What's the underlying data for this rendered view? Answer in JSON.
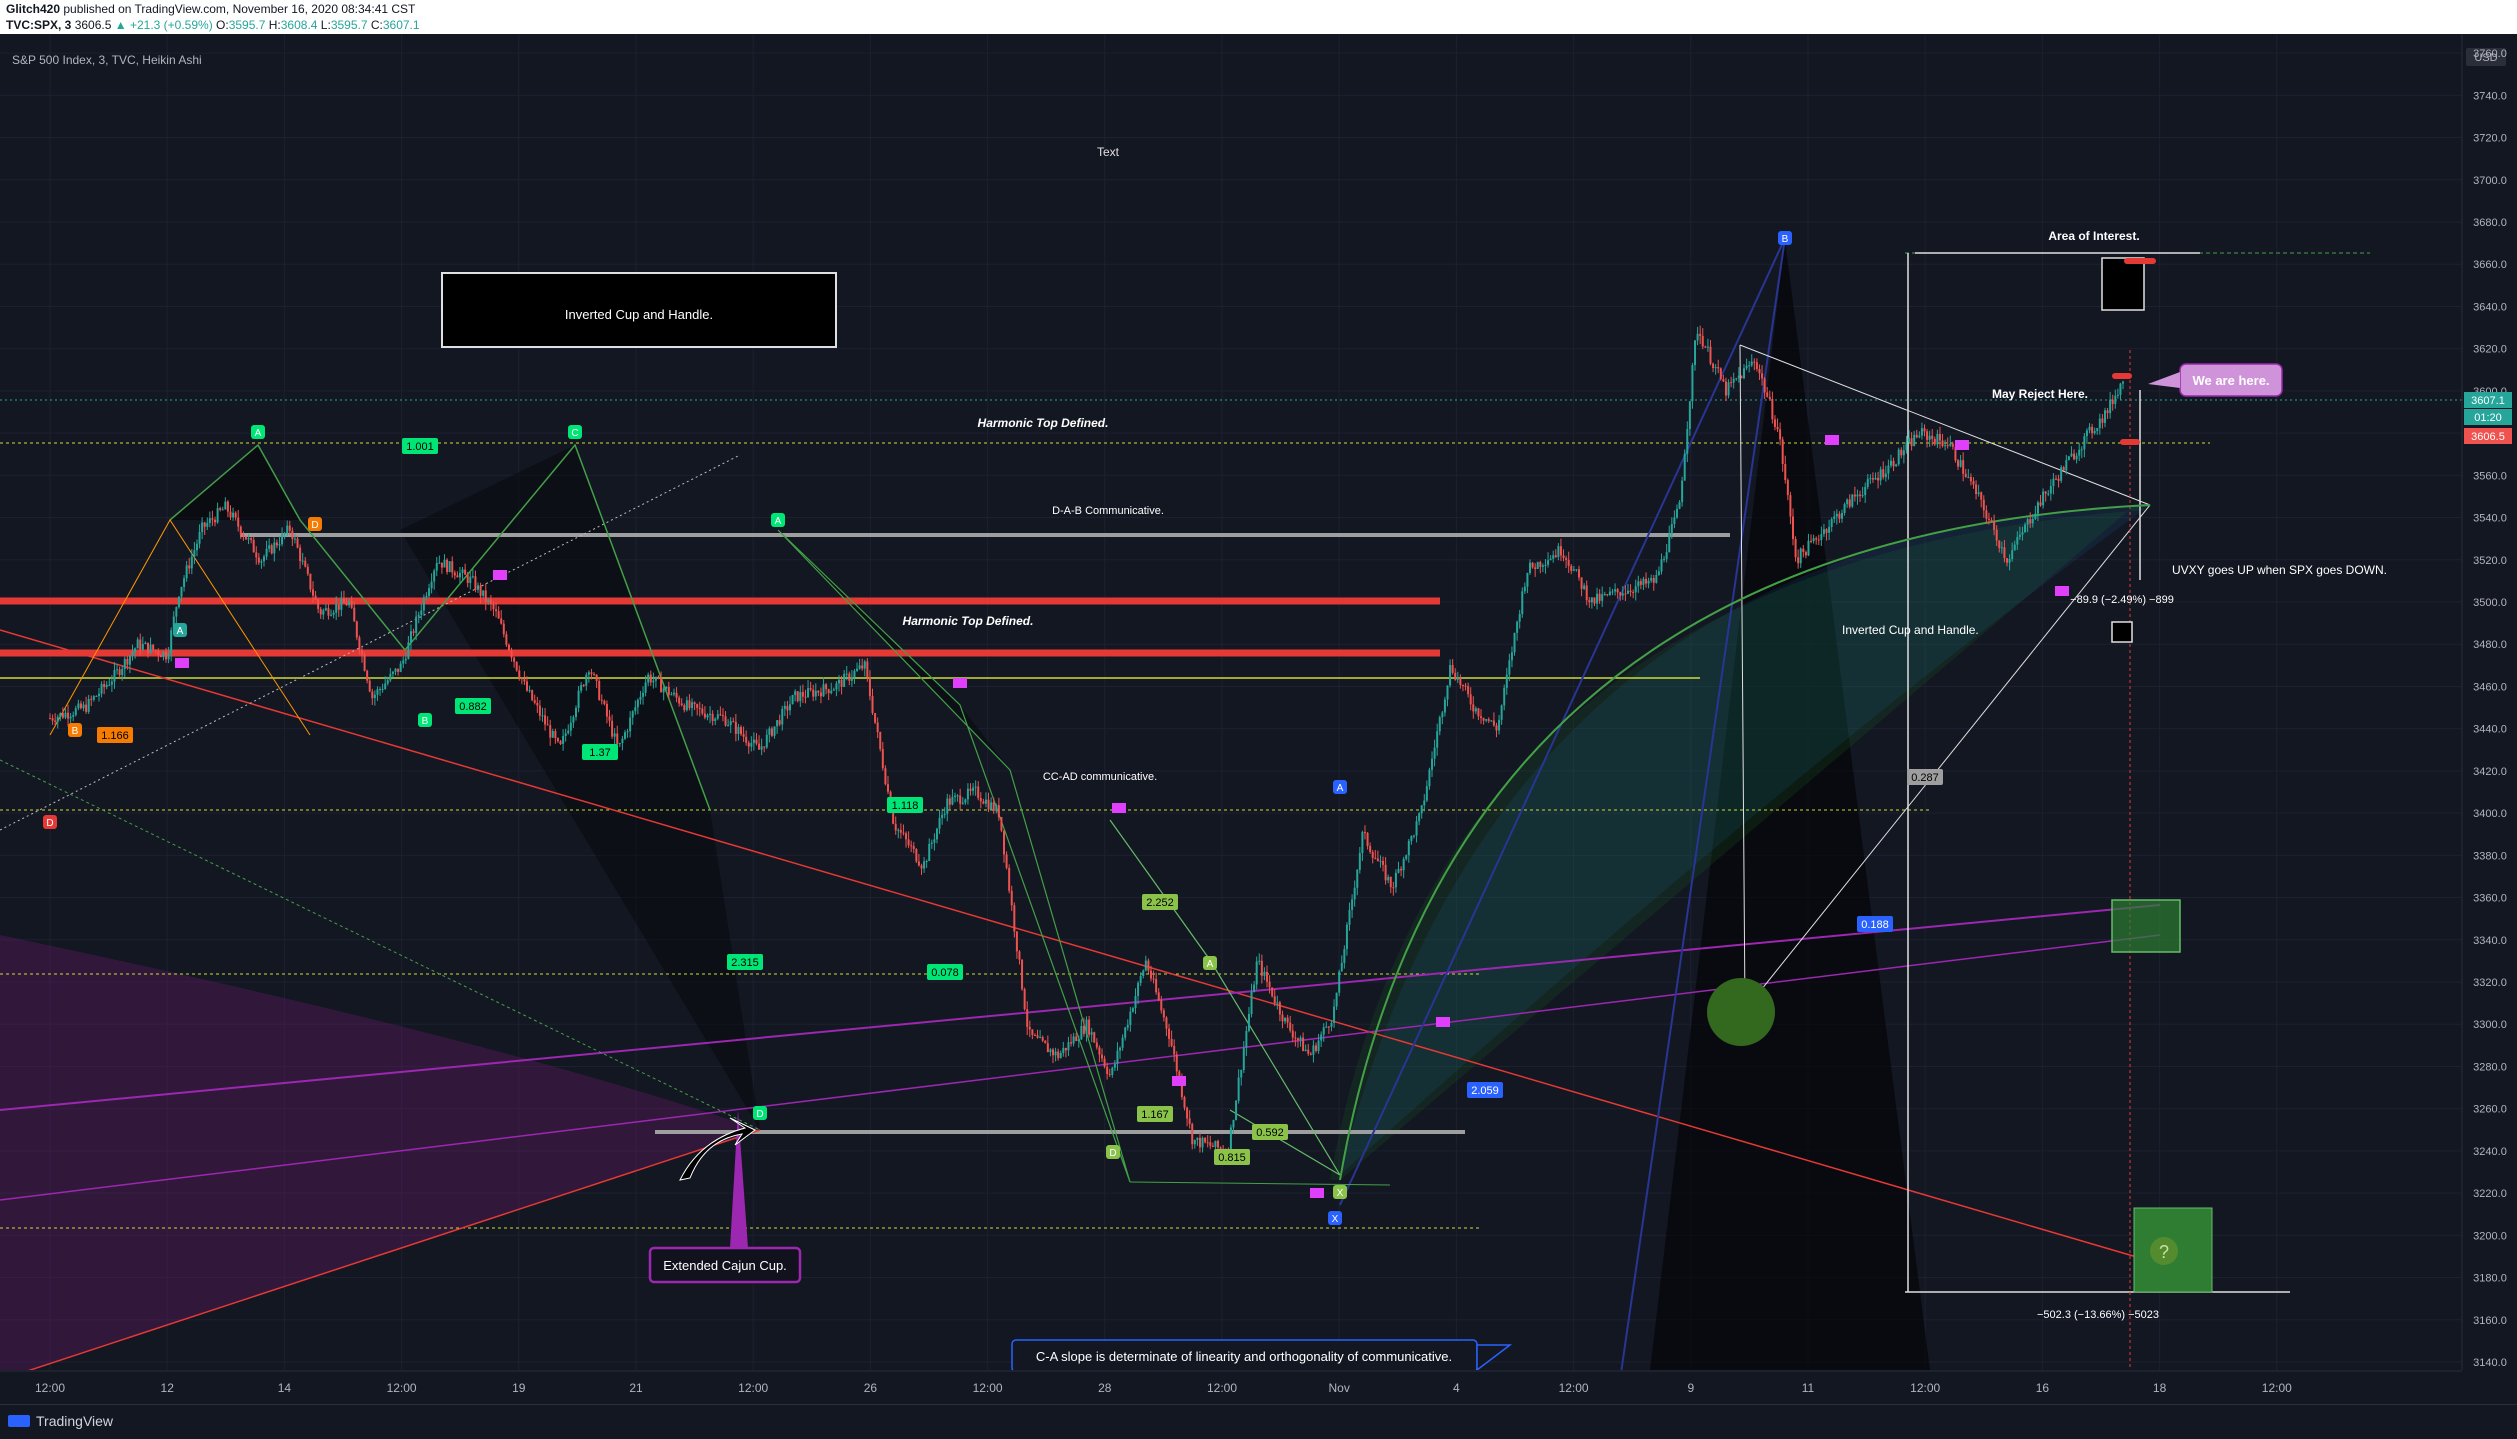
{
  "header": {
    "author": "Glitch420",
    "published_text": "published on TradingView.com, November 16, 2020 08:34:41 CST",
    "symbol": "TVC:SPX, 3",
    "last": "3606.5",
    "change": "▲ +21.3 (+0.59%)",
    "o_label": "O:",
    "o": "3595.7",
    "h_label": "H:",
    "h": "3608.4",
    "l_label": "L:",
    "l": "3595.7",
    "c_label": "C:",
    "c": "3607.1"
  },
  "legend_title": "S&P 500 Index, 3, TVC, Heikin Ashi",
  "footer": {
    "brand": "TradingView"
  },
  "price_axis": {
    "currency": "USD",
    "current_price": "3607.1",
    "countdown": "01:20",
    "last_price": "3606.5"
  },
  "annotations": {
    "text_label": "Text",
    "inverted_cup_box": "Inverted Cup and Handle.",
    "harmonic_top_1": "Harmonic Top Defined.",
    "harmonic_top_2": "Harmonic Top Defined.",
    "dab": "D-A-B Communicative.",
    "ccad": "CC-AD communicative.",
    "area_of_interest": "Area of Interest.",
    "may_reject": "May Reject Here.",
    "we_are_here": "We are here.",
    "uvxy": "UVXY goes UP when SPX goes DOWN.",
    "inverted_cup_2": "Inverted Cup and Handle.",
    "extended_cajun": "Extended Cajun Cup.",
    "ca_slope": "C-A slope is determinate of linearity and orthogonality of communicative.",
    "measure_small": "−89.9 (−2.49%) −899",
    "measure_big": "−502.3 (−13.66%) −5023"
  },
  "colors": {
    "background": "#131722",
    "up": "#26a69a",
    "down": "#ef5350",
    "accent_green": "#00e676",
    "accent_magenta": "#e040fb",
    "accent_orange": "#f57c00",
    "accent_blue": "#2962ff",
    "red_line": "#e53935",
    "purple": "#9c27b0"
  },
  "chart_data": {
    "type": "candlestick",
    "title": "S&P 500 Index, 3, TVC, Heikin Ashi",
    "y_range": [
      3140,
      3770
    ],
    "y_ticks": [
      3140,
      3160,
      3180,
      3200,
      3220,
      3240,
      3260,
      3280,
      3300,
      3320,
      3340,
      3360,
      3380,
      3400,
      3420,
      3440,
      3460,
      3480,
      3500,
      3520,
      3540,
      3560,
      3580,
      3600,
      3620,
      3640,
      3660,
      3680,
      3700,
      3720,
      3740,
      3760
    ],
    "x_ticks": [
      {
        "label": "12:00",
        "x": 0
      },
      {
        "label": "12",
        "x": 1
      },
      {
        "label": "14",
        "x": 2
      },
      {
        "label": "12:00",
        "x": 3
      },
      {
        "label": "19",
        "x": 4
      },
      {
        "label": "21",
        "x": 5
      },
      {
        "label": "12:00",
        "x": 6
      },
      {
        "label": "26",
        "x": 7
      },
      {
        "label": "12:00",
        "x": 8
      },
      {
        "label": "28",
        "x": 9
      },
      {
        "label": "12:00",
        "x": 10
      },
      {
        "label": "Nov",
        "x": 11
      },
      {
        "label": "4",
        "x": 12
      },
      {
        "label": "12:00",
        "x": 13
      },
      {
        "label": "9",
        "x": 14
      },
      {
        "label": "11",
        "x": 15
      },
      {
        "label": "12:00",
        "x": 16
      },
      {
        "label": "16",
        "x": 17
      },
      {
        "label": "18",
        "x": 18
      },
      {
        "label": "12:00",
        "x": 19
      }
    ],
    "price_path": [
      [
        0.0,
        3445
      ],
      [
        0.3,
        3450
      ],
      [
        0.55,
        3465
      ],
      [
        0.75,
        3480
      ],
      [
        1.0,
        3475
      ],
      [
        1.1,
        3505
      ],
      [
        1.3,
        3535
      ],
      [
        1.5,
        3545
      ],
      [
        1.8,
        3520
      ],
      [
        2.05,
        3535
      ],
      [
        2.3,
        3495
      ],
      [
        2.55,
        3500
      ],
      [
        2.75,
        3455
      ],
      [
        3.0,
        3470
      ],
      [
        3.3,
        3520
      ],
      [
        3.6,
        3510
      ],
      [
        3.8,
        3495
      ],
      [
        4.05,
        3460
      ],
      [
        4.35,
        3430
      ],
      [
        4.6,
        3470
      ],
      [
        4.85,
        3430
      ],
      [
        5.1,
        3465
      ],
      [
        5.45,
        3450
      ],
      [
        5.75,
        3445
      ],
      [
        6.05,
        3430
      ],
      [
        6.35,
        3455
      ],
      [
        6.7,
        3460
      ],
      [
        6.95,
        3470
      ],
      [
        7.2,
        3395
      ],
      [
        7.45,
        3375
      ],
      [
        7.65,
        3405
      ],
      [
        7.9,
        3410
      ],
      [
        8.1,
        3400
      ],
      [
        8.35,
        3295
      ],
      [
        8.6,
        3285
      ],
      [
        8.85,
        3300
      ],
      [
        9.05,
        3275
      ],
      [
        9.35,
        3330
      ],
      [
        9.55,
        3295
      ],
      [
        9.75,
        3245
      ],
      [
        10.05,
        3240
      ],
      [
        10.3,
        3330
      ],
      [
        10.55,
        3300
      ],
      [
        10.75,
        3285
      ],
      [
        10.95,
        3305
      ],
      [
        11.2,
        3390
      ],
      [
        11.45,
        3365
      ],
      [
        11.7,
        3400
      ],
      [
        11.95,
        3470
      ],
      [
        12.15,
        3450
      ],
      [
        12.35,
        3440
      ],
      [
        12.6,
        3515
      ],
      [
        12.9,
        3525
      ],
      [
        13.15,
        3500
      ],
      [
        13.4,
        3505
      ],
      [
        13.7,
        3510
      ],
      [
        13.9,
        3545
      ],
      [
        14.05,
        3630
      ],
      [
        14.3,
        3600
      ],
      [
        14.55,
        3615
      ],
      [
        14.75,
        3580
      ],
      [
        14.9,
        3520
      ],
      [
        15.15,
        3535
      ],
      [
        15.4,
        3550
      ],
      [
        15.7,
        3565
      ],
      [
        15.95,
        3580
      ],
      [
        16.2,
        3575
      ],
      [
        16.45,
        3550
      ],
      [
        16.7,
        3520
      ],
      [
        16.95,
        3545
      ],
      [
        17.2,
        3565
      ],
      [
        17.4,
        3580
      ],
      [
        17.55,
        3590
      ],
      [
        17.7,
        3607
      ]
    ],
    "fib_labels": [
      "1.001",
      "1.166",
      "0.882",
      "1.37",
      "1.118",
      "2.315",
      "0.078",
      "2.252",
      "1.167",
      "0.815",
      "0.592",
      "2.059",
      "0.188",
      "0.287"
    ],
    "point_labels": [
      "A",
      "B",
      "C",
      "D",
      "X"
    ]
  }
}
